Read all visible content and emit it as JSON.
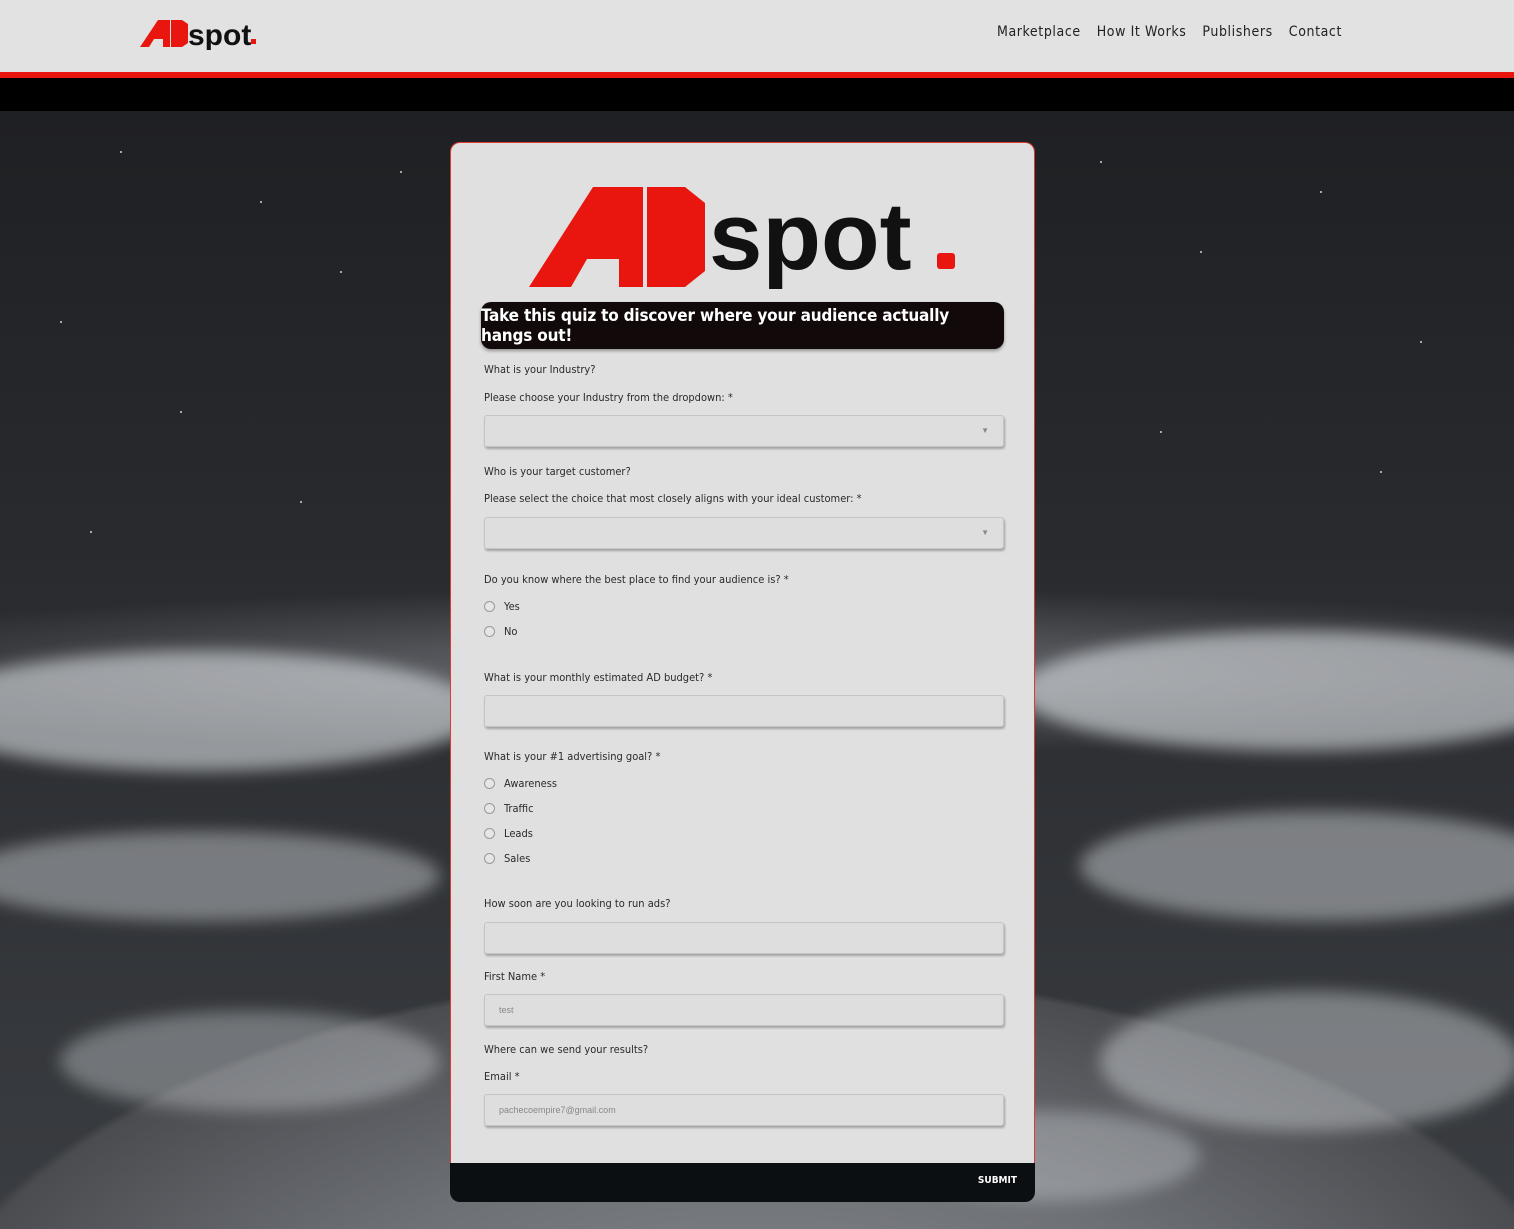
{
  "header": {
    "logo_text_a": "A",
    "logo_text_d": "D",
    "logo_text_spot": "spot",
    "nav": [
      {
        "label": "Marketplace"
      },
      {
        "label": "How It Works"
      },
      {
        "label": "Publishers"
      },
      {
        "label": "Contact"
      }
    ]
  },
  "colors": {
    "brand_red": "#e8160f",
    "dark": "#0c0f12",
    "card_bg": "#e0e0e0"
  },
  "card": {
    "banner": "Take this quiz to discover where your audience actually hangs out!",
    "industry_heading": "What is your Industry?",
    "industry_label": "Please choose your Industry from the dropdown: *",
    "industry_value": "",
    "customer_heading": "Who is your target customer?",
    "customer_label": "Please select the choice that most closely aligns with your ideal customer: *",
    "customer_value": "",
    "know_label": "Do you know where the best place to find your audience is? *",
    "know_options": [
      "Yes",
      "No"
    ],
    "budget_label": "What is your monthly estimated AD budget? *",
    "budget_value": "",
    "goal_label": "What is your #1 advertising goal? *",
    "goal_options": [
      "Awareness",
      "Traffic",
      "Leads",
      "Sales"
    ],
    "soon_label": "How soon are you looking to run ads?",
    "soon_value": "",
    "firstname_label": "First Name *",
    "firstname_value": "test",
    "results_heading": "Where can we send your results?",
    "email_label": "Email *",
    "email_value": "pachecoempire7@gmail.com",
    "submit_label": "SUBMIT"
  },
  "icons": {
    "dropdown": "chevron-down-icon",
    "radio": "radio-icon"
  }
}
